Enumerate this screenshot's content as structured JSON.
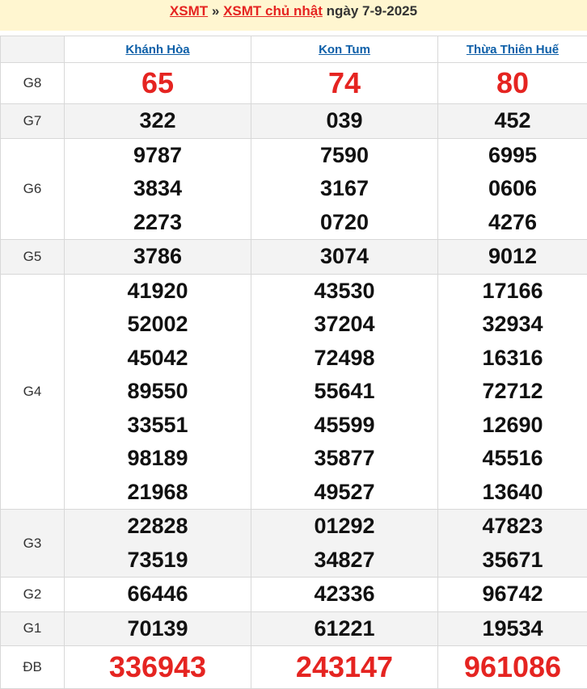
{
  "header": {
    "link1": "XSMT",
    "separator": "»",
    "link2": "XSMT chủ nhật",
    "date_text": "ngày 7-9-2025"
  },
  "provinces": [
    "Khánh Hòa",
    "Kon Tum",
    "Thừa Thiên Huế"
  ],
  "prizes": [
    {
      "label": "G8",
      "values": [
        [
          "65"
        ],
        [
          "74"
        ],
        [
          "80"
        ]
      ]
    },
    {
      "label": "G7",
      "values": [
        [
          "322"
        ],
        [
          "039"
        ],
        [
          "452"
        ]
      ]
    },
    {
      "label": "G6",
      "values": [
        [
          "9787",
          "3834",
          "2273"
        ],
        [
          "7590",
          "3167",
          "0720"
        ],
        [
          "6995",
          "0606",
          "4276"
        ]
      ]
    },
    {
      "label": "G5",
      "values": [
        [
          "3786"
        ],
        [
          "3074"
        ],
        [
          "9012"
        ]
      ]
    },
    {
      "label": "G4",
      "values": [
        [
          "41920",
          "52002",
          "45042",
          "89550",
          "33551",
          "98189",
          "21968"
        ],
        [
          "43530",
          "37204",
          "72498",
          "55641",
          "45599",
          "35877",
          "49527"
        ],
        [
          "17166",
          "32934",
          "16316",
          "72712",
          "12690",
          "45516",
          "13640"
        ]
      ]
    },
    {
      "label": "G3",
      "values": [
        [
          "22828",
          "73519"
        ],
        [
          "01292",
          "34827"
        ],
        [
          "47823",
          "35671"
        ]
      ]
    },
    {
      "label": "G2",
      "values": [
        [
          "66446"
        ],
        [
          "42336"
        ],
        [
          "96742"
        ]
      ]
    },
    {
      "label": "G1",
      "values": [
        [
          "70139"
        ],
        [
          "61221"
        ],
        [
          "19534"
        ]
      ]
    },
    {
      "label": "ĐB",
      "values": [
        [
          "336943"
        ],
        [
          "243147"
        ],
        [
          "961086"
        ]
      ]
    }
  ],
  "colors": {
    "accent_red": "#e52421",
    "link_blue": "#0d5fa8",
    "header_bg": "#fff6d0",
    "alt_row_bg": "#f3f3f3"
  }
}
